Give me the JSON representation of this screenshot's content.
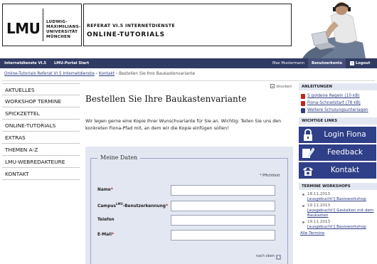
{
  "header": {
    "logo_text": "LMU",
    "university_line1": "LUDWIG-",
    "university_line2": "MAXIMILIANS-",
    "university_line3": "UNIVERSITÄT",
    "university_line4": "MÜNCHEN",
    "department": "REFERAT VI.5 INTERNETDIENSTE",
    "site_title": "ONLINE-TUTORIALS"
  },
  "nav": {
    "home": "Internetdienste VI.5",
    "portal": "LMU-Portal Start",
    "user": "Max Mustermann",
    "account": "Benutzerkonto",
    "logout": "Logout"
  },
  "breadcrumb": {
    "item1": "Online-Tutorials Referat VI.5 Internetdienste",
    "item2": "Kontakt",
    "current": "Bestellen Sie Ihre Baukastenvariante"
  },
  "sidebar": {
    "items": [
      {
        "label": "AKTUELLES"
      },
      {
        "label": "WORKSHOP TERMINE"
      },
      {
        "label": "SPICKZETTEL"
      },
      {
        "label": "ONLINE-TUTORIALS"
      },
      {
        "label": "EXTRAS"
      },
      {
        "label": "THEMEN A-Z"
      },
      {
        "label": "LMU-WEBREDAKTEURE"
      },
      {
        "label": "KONTAKT"
      }
    ]
  },
  "main": {
    "print_label": "drucken",
    "title": "Bestellen Sie Ihre Baukastenvariante",
    "intro": "Wir legen gerne eine Kopie Ihrer Wunschvariante für Sie an. Wichtig: Teilen Sie uns den konkreten Fiona-Pfad mit, an dem wir die Kopie einfügen sollen!",
    "form": {
      "legend": "Meine Daten",
      "required_note": "* Pflichtfeld",
      "name_label": "Name",
      "campus_label_pre": "Campus",
      "campus_label_sup": "LMU",
      "campus_label_post": "-Benutzerkennung",
      "phone_label": "Telefon",
      "email_label": "E-Mail",
      "required_mark": "*",
      "name_value": "",
      "campus_value": "",
      "phone_value": "",
      "email_value": "",
      "top_link": "nach oben",
      "top_arrow": "▲"
    }
  },
  "right": {
    "guides_heading": "ANLEITUNGEN",
    "guides": [
      {
        "label": "5 goldene Regeln (10 kB)"
      },
      {
        "label": "Fiona-Schnellstart (78 kB)"
      },
      {
        "label": "Weitere Schulungsunterlagen"
      }
    ],
    "links_heading": "WICHTIGE LINKS",
    "buttons": [
      {
        "label": "Login Fiona",
        "icon": "lock-icon"
      },
      {
        "label": "Feedback",
        "icon": "pencil-icon"
      },
      {
        "label": "Kontakt",
        "icon": "phone-icon"
      }
    ],
    "workshops_heading": "TERMINE WORKSHOPS",
    "workshops": [
      {
        "date": "18.11.2013",
        "title": "[ausgebucht!] Basisworkshop"
      },
      {
        "date": "19.11.2013",
        "title": "[ausgebucht!] Gestalten mit dem Baukasten"
      },
      {
        "date": "19.11.2013",
        "title": "[ausgebucht!] Basisworkshop"
      }
    ],
    "all_dates": "Alle Termine"
  },
  "colors": {
    "nav_bg": "#303a63",
    "accent_blue": "#2f3f88",
    "form_bg": "#e3e7f2",
    "link": "#2e3d83"
  }
}
